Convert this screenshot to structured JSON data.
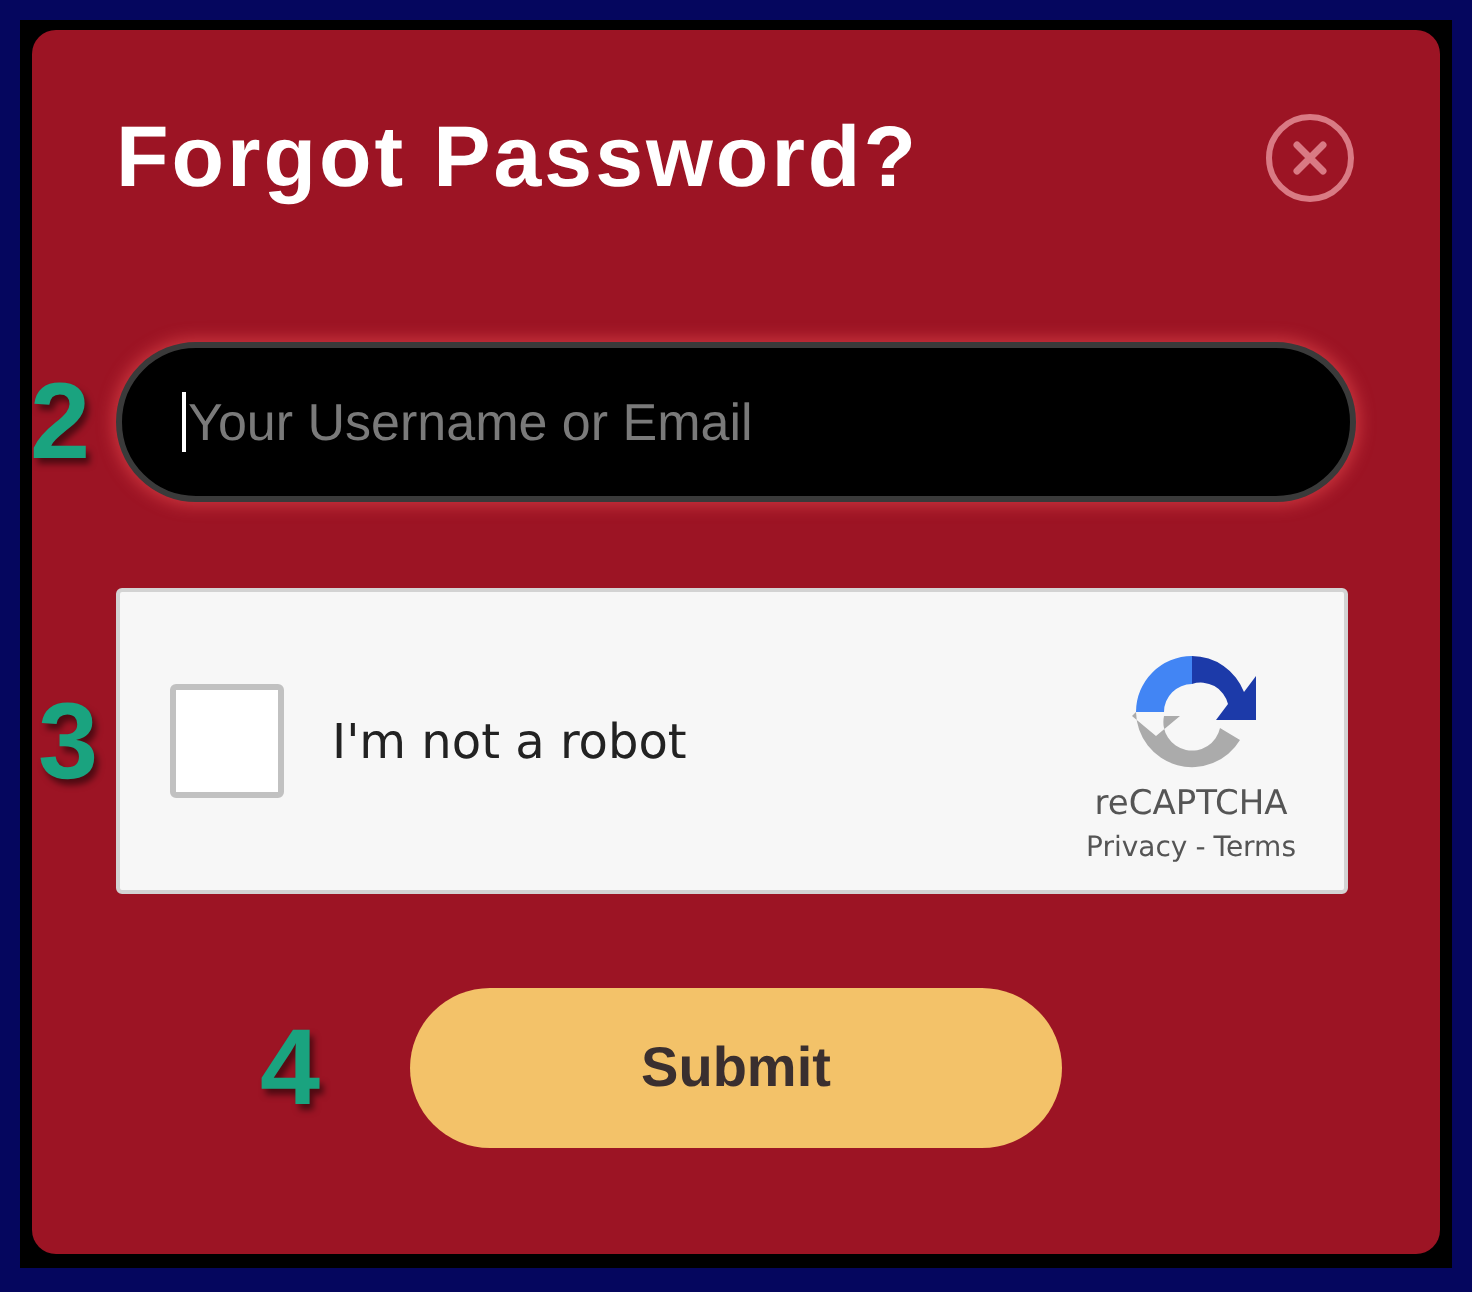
{
  "dialog": {
    "title": "Forgot Password?"
  },
  "username_field": {
    "marker": "2",
    "placeholder": "Your Username or Email",
    "focused": true
  },
  "captcha": {
    "marker": "3",
    "checked": false,
    "label": "I'm not a robot",
    "brand": "reCAPTCHA",
    "links": [
      "Privacy",
      "Terms"
    ],
    "separator": "-"
  },
  "submit": {
    "marker": "4",
    "label": "Submit"
  }
}
